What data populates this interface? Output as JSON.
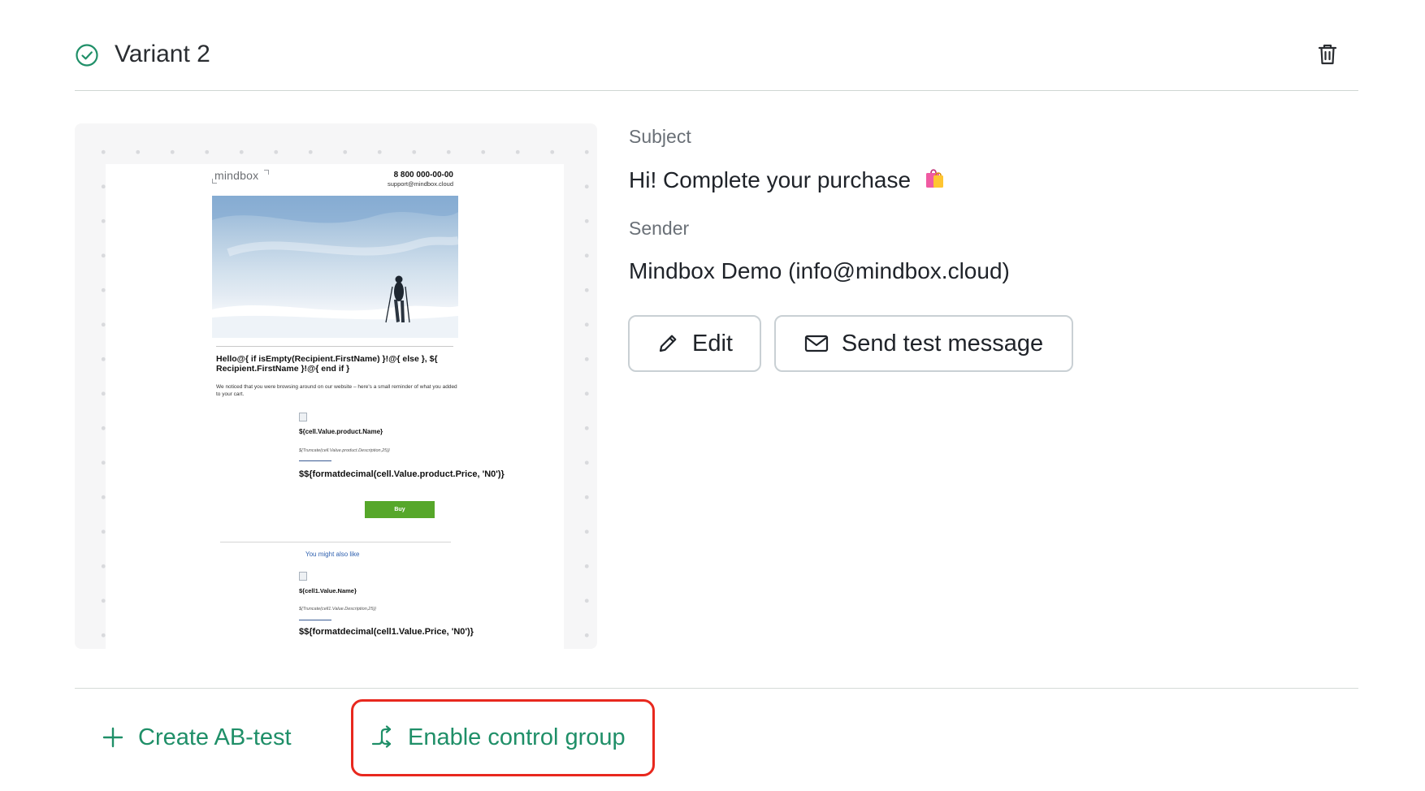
{
  "variant": {
    "title": "Variant 2",
    "status_icon": "check-circle-icon",
    "delete_icon": "trash-icon"
  },
  "preview": {
    "logo": "mindbox",
    "phone": "8 800 000-00-00",
    "support_email": "support@mindbox.cloud",
    "greeting": "Hello@{ if isEmpty(Recipient.FirstName) }!@{ else }, ${ Recipient.FirstName }!@{ end if }",
    "intro": "We noticed that you were browsing around on our website – here's a small reminder of what you added to your cart.",
    "product_name": "${cell.Value.product.Name}",
    "product_desc": "${Truncate(cell.Value.product.Description,25)}",
    "product_price": "$${formatdecimal(cell.Value.product.Price, 'N0')}",
    "buy_label": "Buy",
    "also_like": "You might also like",
    "cell1_name": "${cell1.Value.Name}",
    "cell1_desc": "${Truncate(cell1.Value.Description,25)}",
    "cell1_price": "$${formatdecimal(cell1.Value.Price, 'N0')}"
  },
  "details": {
    "subject_label": "Subject",
    "subject_value": "Hi! Complete your purchase",
    "subject_emoji": "shopping-bags-icon",
    "sender_label": "Sender",
    "sender_value": "Mindbox Demo (info@mindbox.cloud)"
  },
  "buttons": {
    "edit": "Edit",
    "edit_icon": "pencil-icon",
    "send_test": "Send test message",
    "send_test_icon": "mail-icon"
  },
  "actions": {
    "create_ab": "Create AB-test",
    "create_ab_icon": "plus-icon",
    "control_group": "Enable control group",
    "control_group_icon": "split-arrows-icon"
  },
  "colors": {
    "accent": "#1f8f68",
    "highlight": "#e8281e",
    "buy_button": "#56a72a"
  }
}
